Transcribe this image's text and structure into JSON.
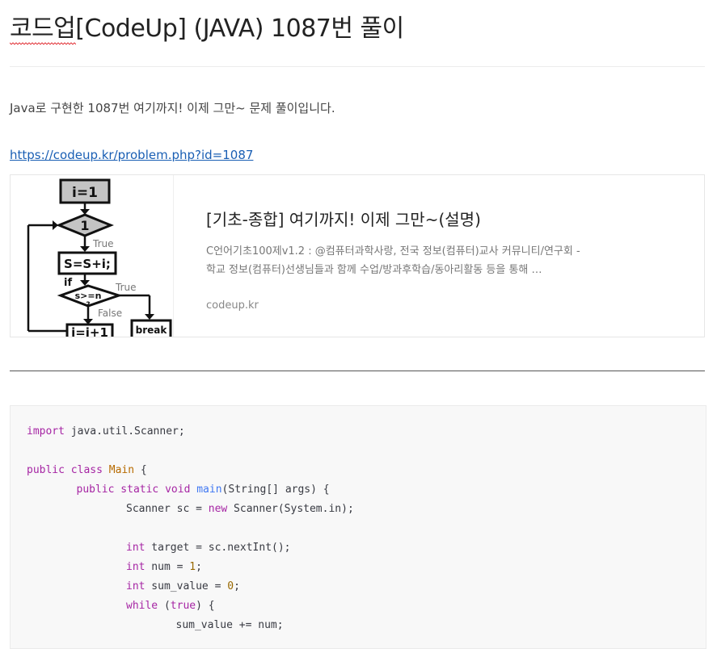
{
  "post": {
    "title": "코드업[CodeUp] (JAVA) 1087번 풀이",
    "intro": "Java로 구현한 1087번 여기까지! 이제 그만~ 문제 풀이입니다.",
    "link": "https://codeup.kr/problem.php?id=1087"
  },
  "card": {
    "title": "[기초-종합] 여기까지! 이제 그만~(설명)",
    "description": "C언어기초100제v1.2 : @컴퓨터과학사랑, 전국 정보(컴퓨터)교사 커뮤니티/연구회 - 학교 정보(컴퓨터)선생님들과 함께 수업/방과후학습/동아리활동 등을 통해 …",
    "domain": "codeup.kr",
    "thumb": {
      "init": "i=1",
      "cond": "1",
      "true1": "True",
      "sum": "S=S+i;",
      "if_label": "if",
      "cmp": "s>=n",
      "q": "?",
      "true2": "True",
      "false_label": "False",
      "incr": "i=i+1",
      "brk": "break"
    }
  },
  "code": [
    {
      "indent": 0,
      "parts": [
        {
          "t": "import",
          "c": "kw"
        },
        {
          "t": " java.util.Scanner;",
          "c": "pl"
        }
      ]
    },
    {
      "indent": 0,
      "parts": []
    },
    {
      "indent": 0,
      "parts": [
        {
          "t": "public",
          "c": "kw"
        },
        {
          "t": " ",
          "c": "pl"
        },
        {
          "t": "class",
          "c": "kw"
        },
        {
          "t": " ",
          "c": "pl"
        },
        {
          "t": "Main",
          "c": "ty"
        },
        {
          "t": " {",
          "c": "pl"
        }
      ]
    },
    {
      "indent": 1,
      "parts": [
        {
          "t": "public",
          "c": "kw"
        },
        {
          "t": " ",
          "c": "pl"
        },
        {
          "t": "static",
          "c": "kw"
        },
        {
          "t": " ",
          "c": "pl"
        },
        {
          "t": "void",
          "c": "kw"
        },
        {
          "t": " ",
          "c": "pl"
        },
        {
          "t": "main",
          "c": "fn"
        },
        {
          "t": "(String[] args) {",
          "c": "pl"
        }
      ]
    },
    {
      "indent": 2,
      "parts": [
        {
          "t": "Scanner sc = ",
          "c": "pl"
        },
        {
          "t": "new",
          "c": "kw"
        },
        {
          "t": " Scanner(System.in);",
          "c": "pl"
        }
      ]
    },
    {
      "indent": 0,
      "parts": []
    },
    {
      "indent": 2,
      "parts": [
        {
          "t": "int",
          "c": "kw"
        },
        {
          "t": " target = sc.nextInt();",
          "c": "pl"
        }
      ]
    },
    {
      "indent": 2,
      "parts": [
        {
          "t": "int",
          "c": "kw"
        },
        {
          "t": " num = ",
          "c": "pl"
        },
        {
          "t": "1",
          "c": "nu"
        },
        {
          "t": ";",
          "c": "pl"
        }
      ]
    },
    {
      "indent": 2,
      "parts": [
        {
          "t": "int",
          "c": "kw"
        },
        {
          "t": " sum_value = ",
          "c": "pl"
        },
        {
          "t": "0",
          "c": "nu"
        },
        {
          "t": ";",
          "c": "pl"
        }
      ]
    },
    {
      "indent": 2,
      "parts": [
        {
          "t": "while",
          "c": "kw"
        },
        {
          "t": " (",
          "c": "pl"
        },
        {
          "t": "true",
          "c": "kw"
        },
        {
          "t": ") {",
          "c": "pl"
        }
      ]
    },
    {
      "indent": 3,
      "parts": [
        {
          "t": "sum_value += num;",
          "c": "pl"
        }
      ]
    }
  ]
}
